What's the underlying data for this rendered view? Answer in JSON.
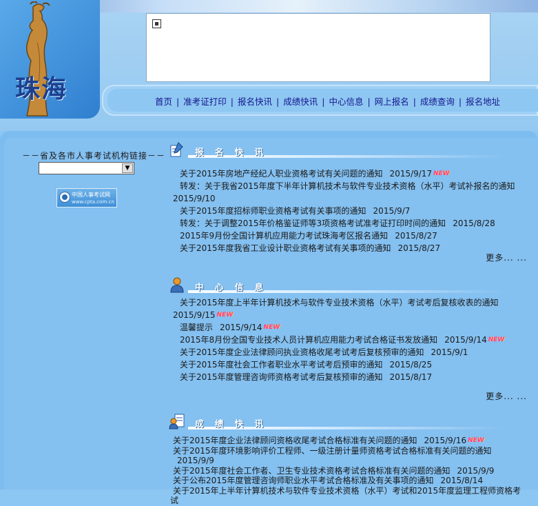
{
  "header": {
    "city_text": "珠海",
    "nav": [
      "首页",
      "准考证打印",
      "报名快讯",
      "成绩快讯",
      "中心信息",
      "网上报名",
      "成绩查询",
      "报名地址"
    ]
  },
  "sidebar": {
    "agency_label": "－－省及各市人事考试机构链接－－",
    "agency_select_value": "",
    "cpta_name": "中国人事考试网",
    "cpta_url": "www.cpta.com.cn"
  },
  "sections": {
    "registration": {
      "title": "报 名 快 讯",
      "more": "更多... ...",
      "items": [
        {
          "title": "关于2015年房地产经纪人职业资格考试有关问题的通知",
          "date": "2015/9/17",
          "is_new": true
        },
        {
          "title": "转发：关于我省2015年度下半年计算机技术与软件专业技术资格（水平）考试补报名的通知",
          "date": "2015/9/10",
          "is_new": false
        },
        {
          "title": "关于2015年度招标师职业资格考试有关事项的通知",
          "date": "2015/9/7",
          "is_new": false
        },
        {
          "title": "转发：关于调整2015年价格鉴证师等3项资格考试准考证打印时间的通知",
          "date": "2015/8/28",
          "is_new": false
        },
        {
          "title": "2015年9月份全国计算机应用能力考试珠海考区报名通知",
          "date": "2015/8/27",
          "is_new": false
        },
        {
          "title": "关于2015年度我省工业设计职业资格考试有关事项的通知",
          "date": "2015/8/27",
          "is_new": false
        }
      ]
    },
    "center_info": {
      "title": "中 心 信 息",
      "more": "更多... ...",
      "items": [
        {
          "title": "关于2015年度上半年计算机技术与软件专业技术资格（水平）考试考后复核收表的通知",
          "date": "2015/9/15",
          "is_new": true
        },
        {
          "title": "温馨提示",
          "date": "2015/9/14",
          "is_new": true
        },
        {
          "title": "2015年8月份全国专业技术人员计算机应用能力考试合格证书发放通知",
          "date": "2015/9/14",
          "is_new": true
        },
        {
          "title": "关于2015年度企业法律顾问执业资格收尾考试考后复核预审的通知",
          "date": "2015/9/1",
          "is_new": false
        },
        {
          "title": "关于2015年度社会工作者职业水平考试考后预审的通知",
          "date": "2015/8/25",
          "is_new": false
        },
        {
          "title": "关于2015年度管理咨询师资格考试考后复核预审的通知",
          "date": "2015/8/17",
          "is_new": false
        }
      ]
    },
    "scores": {
      "title": "成 绩 快 讯",
      "items": [
        {
          "title": "关于2015年度企业法律顾问资格收尾考试合格标准有关问题的通知",
          "date": "2015/9/16",
          "is_new": true
        },
        {
          "title": "关于2015年度环境影响评价工程师、一级注册计量师资格考试合格标准有关问题的通知",
          "date": "2015/9/9",
          "is_new": false
        },
        {
          "title": "关于2015年度社会工作者、卫生专业技术资格考试合格标准有关问题的通知",
          "date": "2015/9/9",
          "is_new": false
        },
        {
          "title": "关于公布2015年度管理咨询师职业水平考试合格标准及有关事项的通知",
          "date": "2015/8/14",
          "is_new": false
        },
        {
          "title": "关于2015年上半年计算机技术与软件专业技术资格（水平）考试和2015年度监理工程师资格考试",
          "date": "",
          "is_new": false
        }
      ]
    },
    "new_badge": "NEW"
  }
}
